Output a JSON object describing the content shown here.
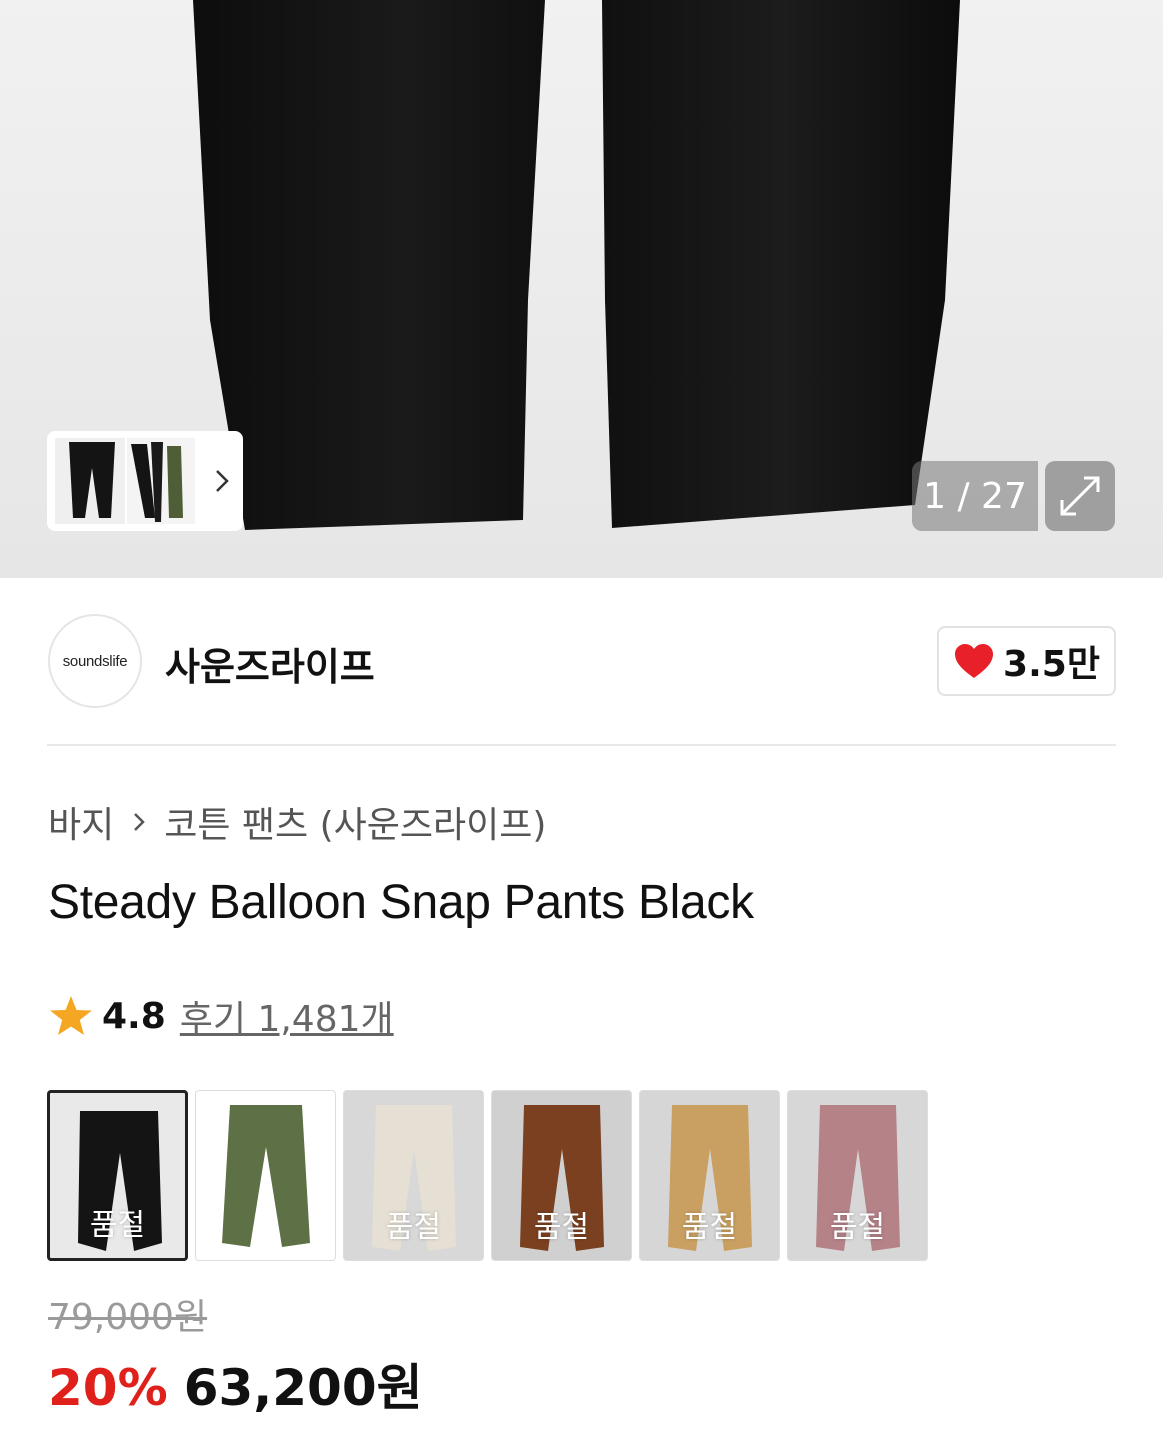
{
  "gallery": {
    "counter": "1 / 27",
    "thumbnails": [
      "black-pants-thumb",
      "black-pants-side-thumb",
      "olive-pants-thumb"
    ]
  },
  "brand": {
    "logo_text": "soundslife",
    "name": "사운즈라이프",
    "like_count": "3.5만",
    "like_color": "#e8202a"
  },
  "breadcrumb": {
    "category": "바지",
    "subcategory": "코튼 팬츠 (사운즈라이프)"
  },
  "product": {
    "title": "Steady Balloon Snap Pants Black"
  },
  "rating": {
    "score": "4.8",
    "reviews": "후기 1,481개",
    "star_color": "#f5a623"
  },
  "options": [
    {
      "color": "black",
      "swatch": "#141414",
      "bg": "#e9e9e9",
      "sold_out_label": "품절",
      "selected": true
    },
    {
      "color": "olive",
      "swatch": "#5e7045",
      "bg": "#ffffff",
      "sold_out_label": "",
      "selected": false
    },
    {
      "color": "ivory",
      "swatch": "#e6e0d4",
      "bg": "#d8d8d8",
      "sold_out_label": "품절",
      "selected": false
    },
    {
      "color": "brown",
      "swatch": "#7a4020",
      "bg": "#d0d0d0",
      "sold_out_label": "품절",
      "selected": false
    },
    {
      "color": "beige",
      "swatch": "#c9a061",
      "bg": "#d6d6d6",
      "sold_out_label": "품절",
      "selected": false
    },
    {
      "color": "pink",
      "swatch": "#b58288",
      "bg": "#d7d7d7",
      "sold_out_label": "품절",
      "selected": false
    }
  ],
  "price": {
    "original": "79,000원",
    "discount": "20%",
    "sale": "63,200원",
    "discount_color": "#e0201a"
  }
}
